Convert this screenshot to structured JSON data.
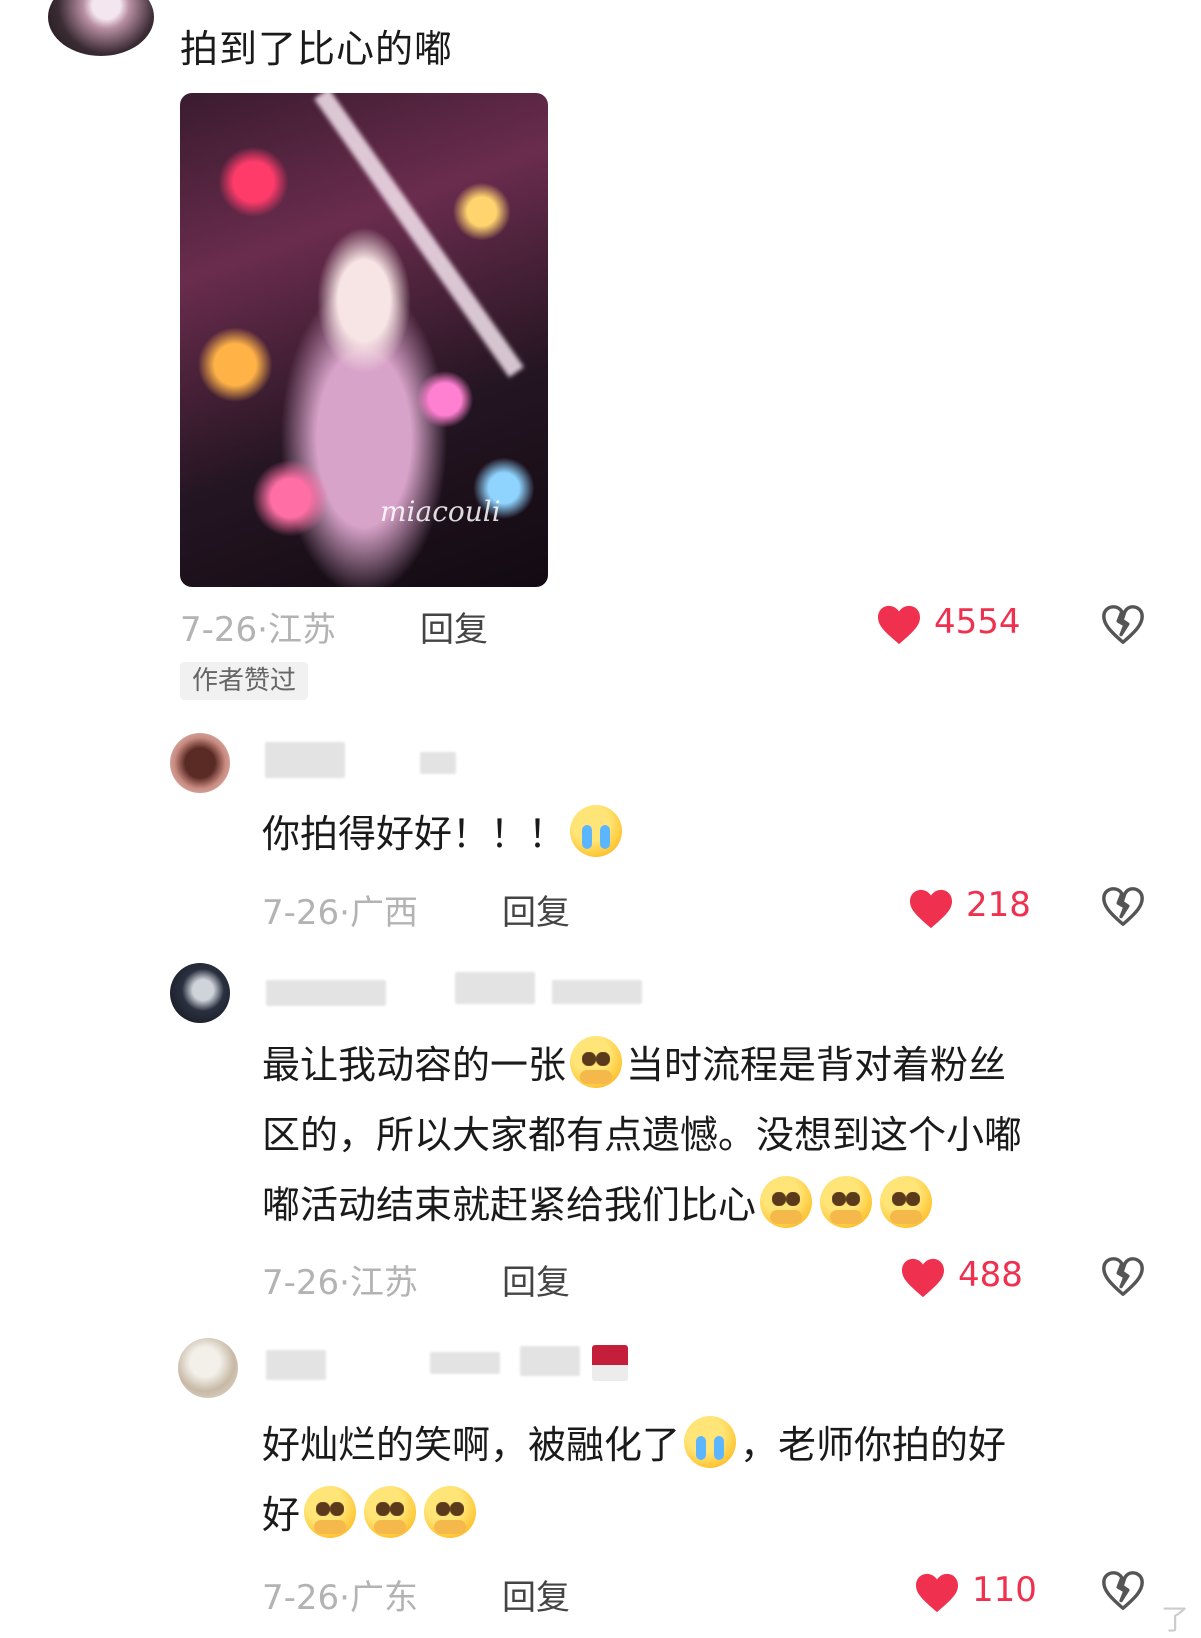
{
  "main_comment": {
    "text": "拍到了比心的嘟",
    "photo_signature": "miacouli",
    "meta": "7-26·江苏",
    "reply_label": "回复",
    "likes": "4554",
    "badge": "作者赞过"
  },
  "replies": [
    {
      "text": "你拍得好好！！！",
      "emoji": [
        "cry"
      ],
      "meta": "7-26·广西",
      "reply_label": "回复",
      "likes": "218"
    },
    {
      "lines": [
        "最让我动容的一张",
        "当时流程是背对着粉丝",
        "区的，所以大家都有点遗憾。没想到这个小嘟",
        "嘟活动结束就赶紧给我们比心"
      ],
      "meta": "7-26·江苏",
      "reply_label": "回复",
      "likes": "488"
    },
    {
      "lines": [
        "好灿烂的笑啊，被融化了",
        "，老师你拍的好",
        "好"
      ],
      "meta": "7-26·广东",
      "reply_label": "回复",
      "likes": "110"
    }
  ],
  "corner_text": "了",
  "colors": {
    "like": "#f0304f",
    "meta": "#b3b3b3",
    "text": "#1a1a1a"
  }
}
